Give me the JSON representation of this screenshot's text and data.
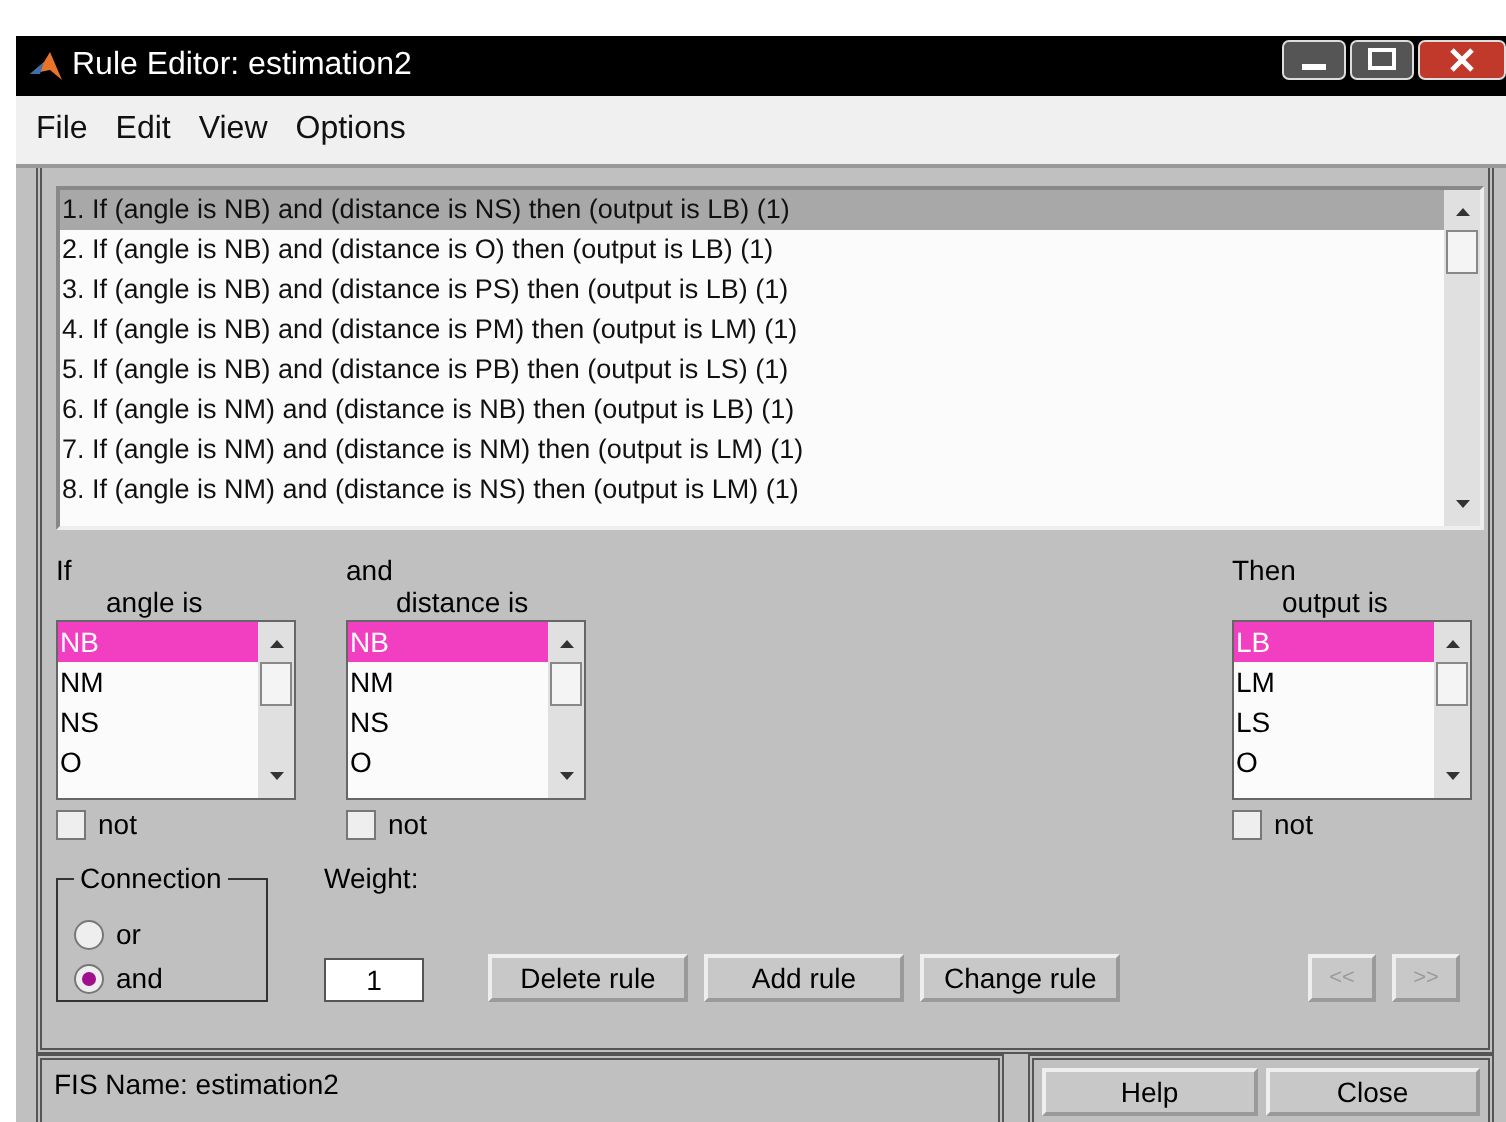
{
  "window": {
    "title": "Rule Editor: estimation2"
  },
  "menu": [
    "File",
    "Edit",
    "View",
    "Options"
  ],
  "rules": [
    {
      "text": "1. If (angle is NB) and (distance is NS) then (output is LB) (1)",
      "selected": true
    },
    {
      "text": "2. If (angle is NB) and (distance is O) then (output is LB) (1)",
      "selected": false
    },
    {
      "text": "3. If (angle is NB) and (distance is PS) then (output is LB) (1)",
      "selected": false
    },
    {
      "text": "4. If (angle is NB) and (distance is PM) then (output is LM) (1)",
      "selected": false
    },
    {
      "text": "5. If (angle is NB) and (distance is PB) then (output is LS) (1)",
      "selected": false
    },
    {
      "text": "6. If (angle is NM) and (distance is NB) then (output is LB) (1)",
      "selected": false
    },
    {
      "text": "7. If (angle is NM) and (distance is NM) then (output is LM) (1)",
      "selected": false
    },
    {
      "text": "8. If (angle is NM) and (distance is NS) then (output is LM) (1)",
      "selected": false
    }
  ],
  "variables": [
    {
      "prefix": "If",
      "label": "angle is",
      "items": [
        {
          "text": "NB",
          "selected": true
        },
        {
          "text": "NM",
          "selected": false
        },
        {
          "text": "NS",
          "selected": false
        },
        {
          "text": "O",
          "selected": false
        }
      ],
      "not": {
        "label": "not",
        "checked": false
      }
    },
    {
      "prefix": "and",
      "label": "distance is",
      "items": [
        {
          "text": "NB",
          "selected": true
        },
        {
          "text": "NM",
          "selected": false
        },
        {
          "text": "NS",
          "selected": false
        },
        {
          "text": "O",
          "selected": false
        }
      ],
      "not": {
        "label": "not",
        "checked": false
      }
    },
    {
      "prefix": "Then",
      "label": "output is",
      "items": [
        {
          "text": "LB",
          "selected": true
        },
        {
          "text": "LM",
          "selected": false
        },
        {
          "text": "LS",
          "selected": false
        },
        {
          "text": "O",
          "selected": false
        }
      ],
      "not": {
        "label": "not",
        "checked": false
      }
    }
  ],
  "connection": {
    "title": "Connection",
    "options": [
      {
        "label": "or",
        "selected": false
      },
      {
        "label": "and",
        "selected": true
      }
    ]
  },
  "weight": {
    "label": "Weight:",
    "value": "1"
  },
  "buttons": [
    {
      "label": "Delete rule",
      "disabled": false
    },
    {
      "label": "Add rule",
      "disabled": false
    },
    {
      "label": "Change rule",
      "disabled": false
    }
  ],
  "nav_buttons": [
    {
      "label": "<<",
      "disabled": true
    },
    {
      "label": ">>",
      "disabled": true
    }
  ],
  "status": "FIS Name: estimation2",
  "footer_buttons": [
    "Help",
    "Close"
  ]
}
